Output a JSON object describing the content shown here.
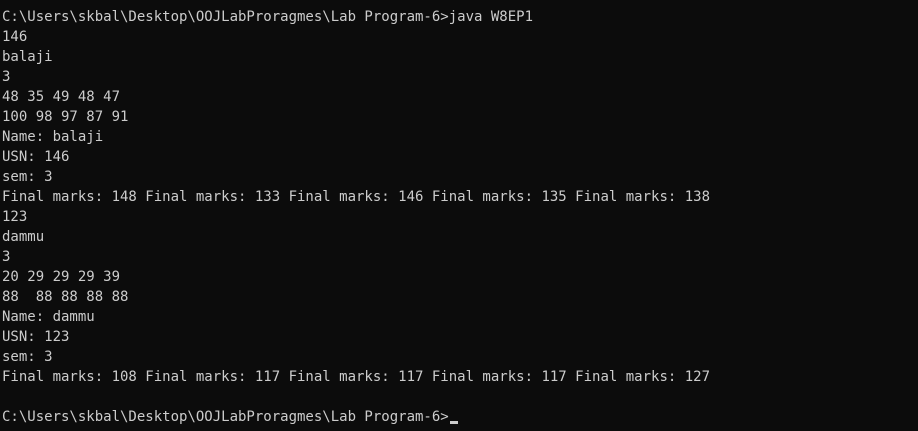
{
  "terminal": {
    "lines": [
      "C:\\Users\\skbal\\Desktop\\OOJLabProragmes\\Lab Program-6>java W8EP1",
      "146",
      "balaji",
      "3",
      "48 35 49 48 47",
      "100 98 97 87 91",
      "Name: balaji",
      "USN: 146",
      "sem: 3",
      "Final marks: 148 Final marks: 133 Final marks: 146 Final marks: 135 Final marks: 138",
      "123",
      "dammu",
      "3",
      "20 29 29 29 39",
      "88  88 88 88 88",
      "Name: dammu",
      "USN: 123",
      "sem: 3",
      "Final marks: 108 Final marks: 117 Final marks: 117 Final marks: 117 Final marks: 127",
      "",
      "C:\\Users\\skbal\\Desktop\\OOJLabProragmes\\Lab Program-6>"
    ]
  }
}
